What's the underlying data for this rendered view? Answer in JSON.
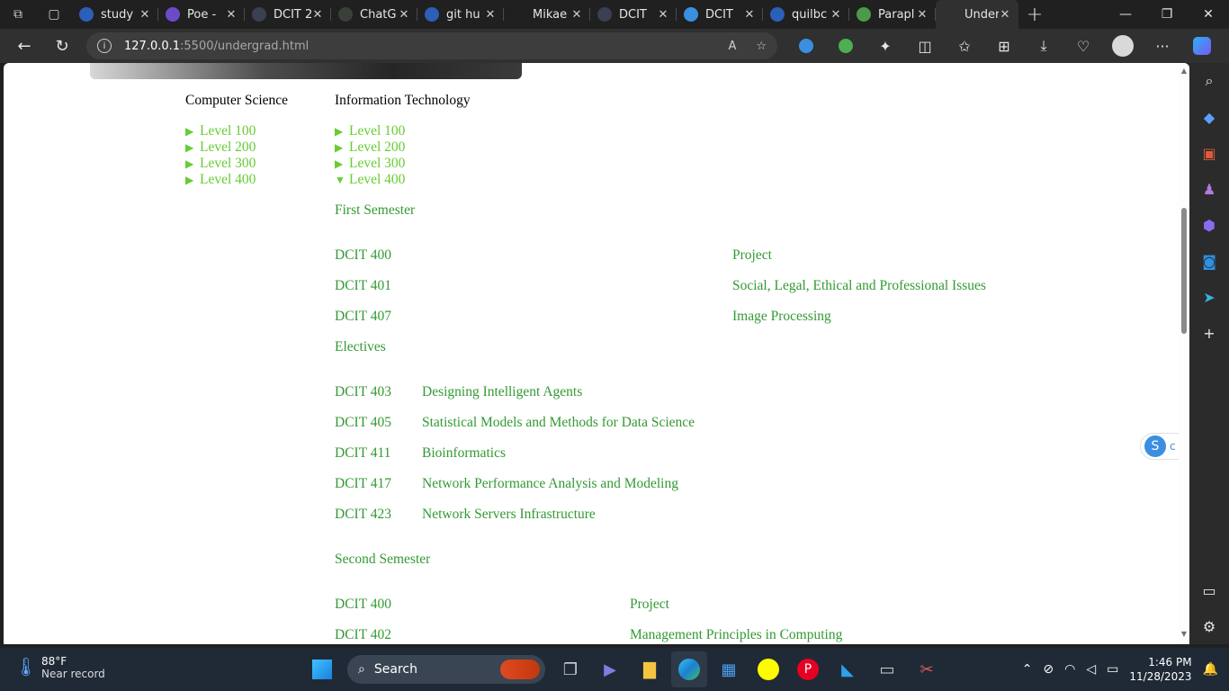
{
  "browser": {
    "tabs": [
      {
        "label": "study",
        "icon": "search-icon",
        "color": "#2b5fb8"
      },
      {
        "label": "Poe -",
        "icon": "poe-icon",
        "color": "#6b4bc7"
      },
      {
        "label": "DCIT 2",
        "icon": "site-icon",
        "color": "#3a3f52"
      },
      {
        "label": "ChatG",
        "icon": "chatgpt-icon",
        "color": "#3a3f3a"
      },
      {
        "label": "git hu",
        "icon": "search-icon",
        "color": "#2b5fb8"
      },
      {
        "label": "Mikae",
        "icon": "github-icon",
        "color": "#202020"
      },
      {
        "label": "DCIT",
        "icon": "site-icon",
        "color": "#3a3f52"
      },
      {
        "label": "DCIT",
        "icon": "s-icon",
        "color": "#3b8fe0"
      },
      {
        "label": "quilbc",
        "icon": "search-icon",
        "color": "#2b5fb8"
      },
      {
        "label": "Parapl",
        "icon": "quillbot-icon",
        "color": "#4a9a4a"
      },
      {
        "label": "Under",
        "icon": "page-icon",
        "color": "#303030"
      }
    ],
    "url_host": "127.0.0.1",
    "url_path": ":5500/undergrad.html"
  },
  "page": {
    "cs_title": "Computer Science",
    "it_title": "Information Technology",
    "cs_levels": [
      "Level 100",
      "Level 200",
      "Level 300",
      "Level 400"
    ],
    "it_levels": [
      "Level 100",
      "Level 200",
      "Level 300",
      "Level 400"
    ],
    "first_semester": "First Semester",
    "first_core": [
      {
        "code": "DCIT 400",
        "name": "Project"
      },
      {
        "code": "DCIT 401",
        "name": "Social, Legal, Ethical and Professional Issues"
      },
      {
        "code": "DCIT 407",
        "name": "Image Processing"
      }
    ],
    "electives_label": "Electives",
    "electives": [
      {
        "code": "DCIT 403",
        "name": "Designing Intelligent Agents"
      },
      {
        "code": "DCIT 405",
        "name": "Statistical Models and Methods for Data Science"
      },
      {
        "code": "DCIT 411",
        "name": "Bioinformatics"
      },
      {
        "code": "DCIT 417",
        "name": "Network Performance Analysis and Modeling"
      },
      {
        "code": "DCIT 423",
        "name": "Network Servers Infrastructure"
      }
    ],
    "second_semester": "Second Semester",
    "second_core": [
      {
        "code": "DCIT 400",
        "name": "Project"
      },
      {
        "code": "DCIT 402",
        "name": "Management Principles in Computing"
      }
    ]
  },
  "taskbar": {
    "temp": "88°F",
    "weather": "Near record",
    "search_label": "Search",
    "time": "1:46 PM",
    "date": "11/28/2023"
  },
  "colors": {
    "level_link": "#66cc33",
    "course_text": "#339933"
  }
}
